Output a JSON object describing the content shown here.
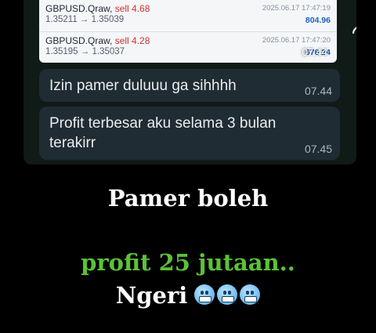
{
  "trades": [
    {
      "symbol": "GBPUSD.Qraw,",
      "side": "sell 4.68",
      "prices": "1.35211 → 1.35039",
      "time": "2025.06.17 17:47:19",
      "profit": "804.96"
    },
    {
      "symbol": "GBPUSD.Qraw,",
      "side": "sell 4.28",
      "prices": "1.35195 → 1.35037",
      "time": "2025.06.17 17:47:20",
      "profit": "676.24"
    }
  ],
  "image_time": "07.44",
  "messages": [
    {
      "text": "Izin pamer duluuu ga sihhhh",
      "time": "07.44"
    },
    {
      "text": "Profit terbesar aku selama 3 bulan terakirr",
      "time": "07.45"
    }
  ],
  "captions": {
    "line1": "Pamer boleh",
    "line2": "profit 25 jutaan..",
    "line3": "Ngeri"
  },
  "icons": {
    "forward": "forward-icon",
    "emoji": "cold-face-emoji"
  },
  "colors": {
    "accent_green": "#5bc236",
    "sell_red": "#d0312d",
    "profit_blue": "#1f5fbf",
    "bubble": "#202c33"
  }
}
